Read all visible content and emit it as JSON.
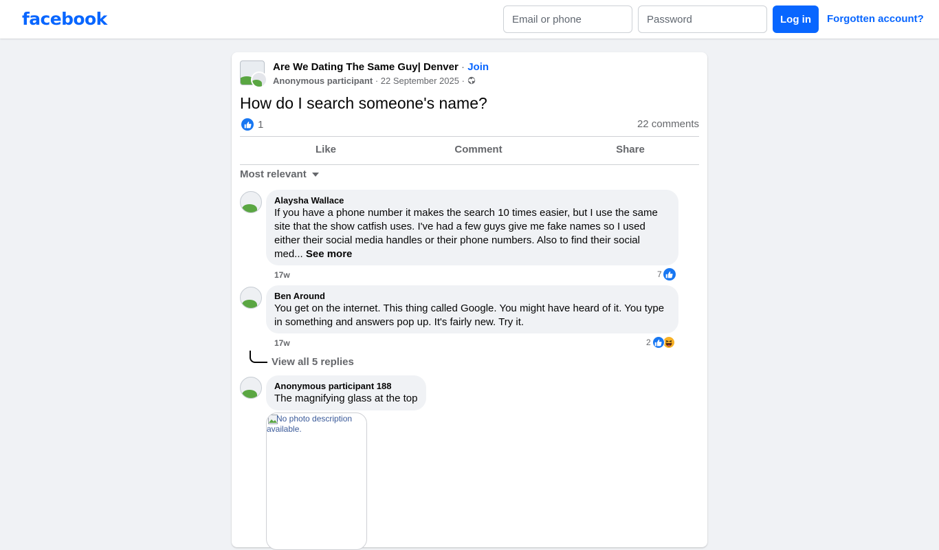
{
  "header": {
    "logo": "facebook",
    "email_placeholder": "Email or phone",
    "password_placeholder": "Password",
    "login_label": "Log in",
    "forgot_label": "Forgotten account?"
  },
  "post": {
    "group_name": "Are We Dating The Same Guy| Denver",
    "separator": " · ",
    "join_label": "Join",
    "author": "Anonymous participant",
    "date": "22 September 2025",
    "privacy_icon": "globe-icon",
    "title": "How do I search someone's name?",
    "like_count": "1",
    "comment_count": "22 comments",
    "actions": {
      "like": "Like",
      "comment": "Comment",
      "share": "Share"
    }
  },
  "sort": {
    "label": "Most relevant"
  },
  "comments": [
    {
      "name": "Alaysha Wallace",
      "text": "If you have a phone number it makes the search 10 times easier, but I use the same site that the show catfish uses. I've had a few guys give me fake names so I used either their social media handles or their phone numbers. Also to find their social med... ",
      "see_more": "See more",
      "time": "17w",
      "reaction_count": "7",
      "reactions": [
        "like"
      ]
    },
    {
      "name": "Ben Around",
      "text": "You get on the internet. This thing called Google. You might have heard of it. You type in something and answers pop up. It's fairly new. Try it.",
      "time": "17w",
      "reaction_count": "2",
      "reactions": [
        "like",
        "haha"
      ],
      "replies_label": "View all 5 replies"
    },
    {
      "name": "Anonymous participant 188",
      "text": "The magnifying glass at the top",
      "attachment_alt": "No photo description available."
    }
  ],
  "colors": {
    "brand": "#0866ff",
    "background": "#f0f2f5",
    "bubble": "#f0f2f5",
    "secondary_text": "#65676b",
    "like_blue": "#1877f2",
    "haha_yellow": "#f7b125"
  }
}
